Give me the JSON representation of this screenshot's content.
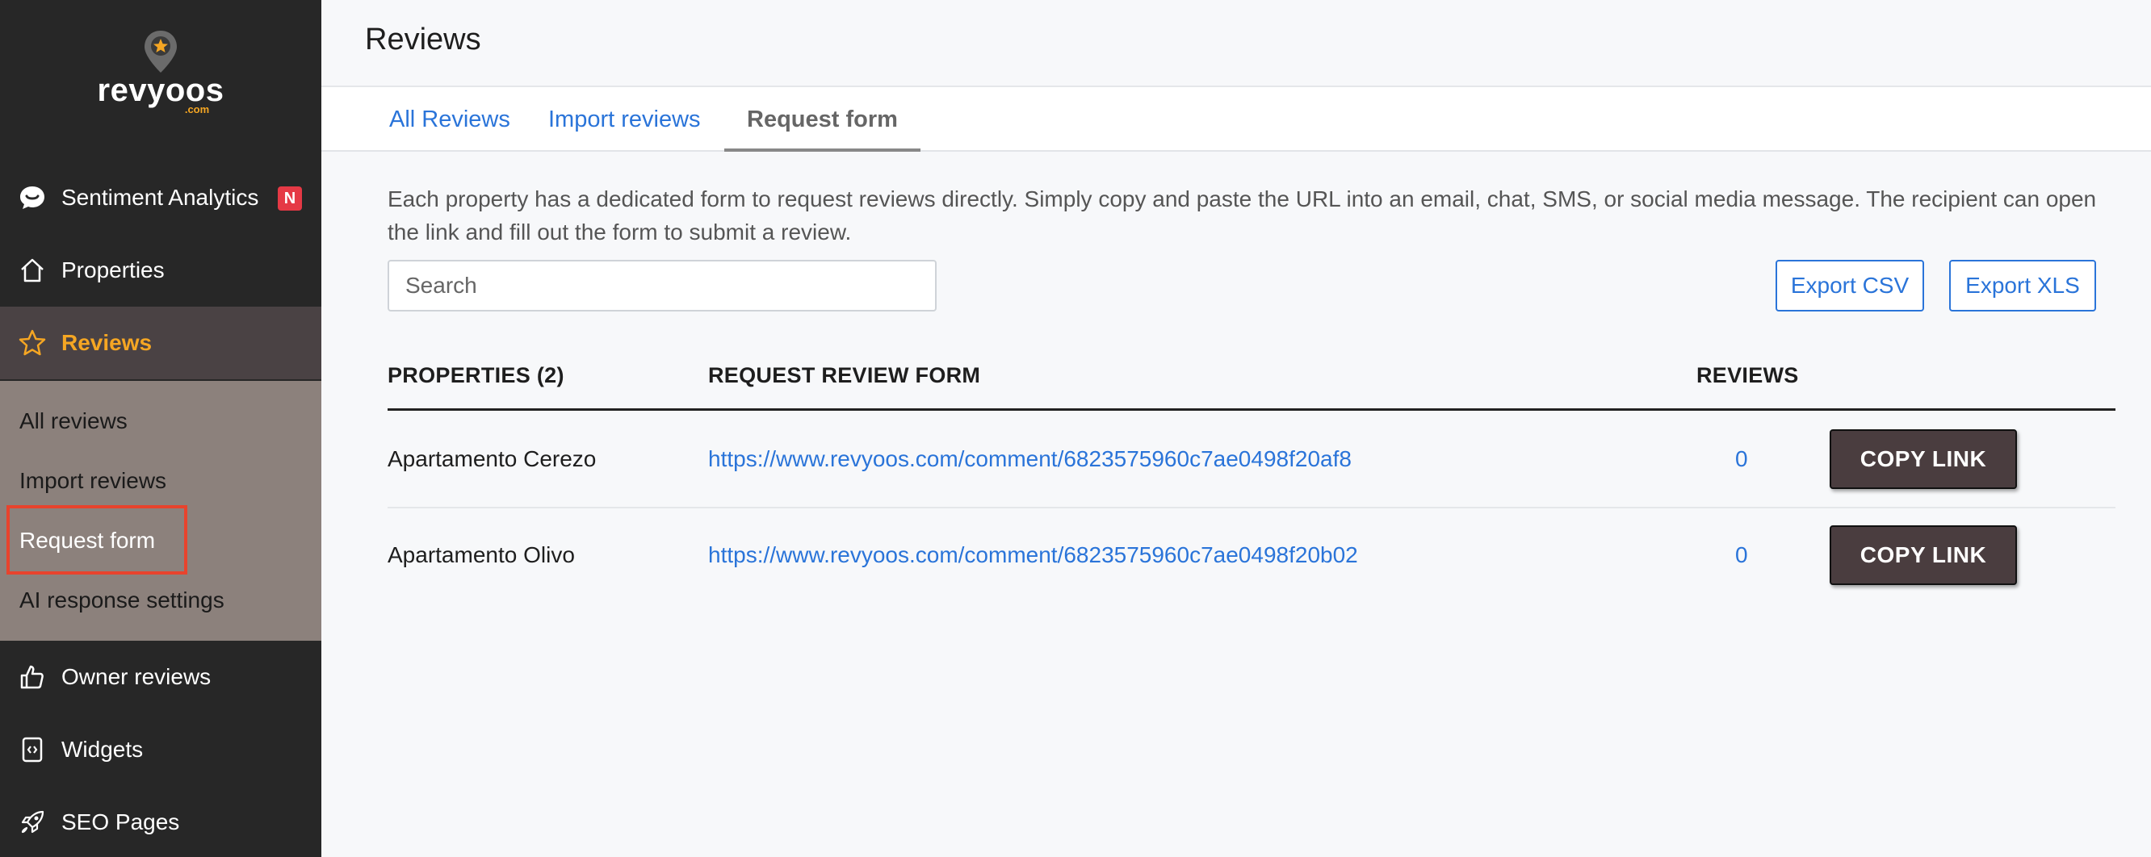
{
  "app": {
    "logo_text": "revyoos",
    "logo_suffix": ".com",
    "brand_accent": "#f5a623"
  },
  "sidebar": {
    "items": [
      {
        "label": "Sentiment Analytics",
        "icon": "chat-bubble-icon",
        "badge": "N"
      },
      {
        "label": "Properties",
        "icon": "home-icon"
      },
      {
        "label": "Reviews",
        "icon": "star-icon",
        "active": true
      },
      {
        "label": "Owner reviews",
        "icon": "thumbs-up-icon"
      },
      {
        "label": "Widgets",
        "icon": "code-file-icon"
      },
      {
        "label": "SEO Pages",
        "icon": "rocket-icon"
      }
    ],
    "submenu": [
      {
        "label": "All reviews"
      },
      {
        "label": "Import reviews"
      },
      {
        "label": "Request form",
        "current": true
      },
      {
        "label": "AI response settings"
      }
    ]
  },
  "header": {
    "title": "Reviews"
  },
  "tabs": [
    {
      "label": "All Reviews"
    },
    {
      "label": "Import reviews"
    },
    {
      "label": "Request form",
      "active": true
    }
  ],
  "content": {
    "description": "Each property has a dedicated form to request reviews directly. Simply copy and paste the URL into an email, chat, SMS, or social media message. The recipient can open the link and fill out the form to submit a review.",
    "search_placeholder": "Search",
    "export_csv": "Export CSV",
    "export_xls": "Export XLS"
  },
  "table": {
    "headers": [
      "PROPERTIES (2)",
      "REQUEST REVIEW FORM",
      "REVIEWS"
    ],
    "rows": [
      {
        "property": "Apartamento Cerezo",
        "url": "https://www.revyoos.com/comment/6823575960c7ae0498f20af8",
        "reviews": "0",
        "action": "COPY LINK"
      },
      {
        "property": "Apartamento Olivo",
        "url": "https://www.revyoos.com/comment/6823575960c7ae0498f20b02",
        "reviews": "0",
        "action": "COPY LINK"
      }
    ]
  }
}
